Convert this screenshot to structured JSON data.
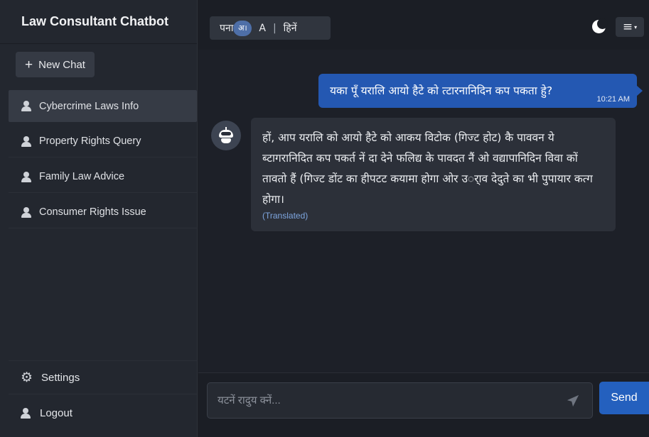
{
  "sidebar": {
    "title": "Law Consultant Chatbot",
    "new_chat_label": "New Chat",
    "new_chat_icon": "plus-icon",
    "items": [
      {
        "label": "Cybercrime Laws Info",
        "active": true,
        "icon": "user-icon"
      },
      {
        "label": "Property Rights Query",
        "active": false,
        "icon": "user-icon"
      },
      {
        "label": "Family Law Advice",
        "active": false,
        "icon": "user-icon"
      },
      {
        "label": "Consumer Rights Issue",
        "active": false,
        "icon": "user-icon"
      }
    ],
    "settings_label": "Settings",
    "settings_icon": "gear-icon",
    "logout_label": "Logout",
    "logout_icon": "user-icon"
  },
  "topbar": {
    "lang_left": "पना",
    "lang_toggle": "अ।",
    "lang_a": "A",
    "lang_sep": "|",
    "lang_right": "हिनें",
    "theme_icon": "moon-icon",
    "menu_icon": "hamburger-menu-icon"
  },
  "chat": {
    "user_message": "यका पूँ यरालि आयो हैटे को त्टारनानिदिन कप पकता हुे?",
    "user_time": "10:21 AM",
    "bot_avatar_icon": "robot-icon",
    "bot_message": "हों, आप यरालि को आयो हैटे को आकय विटोक (गिज्ट होट) कै पाववन ये ब्टागरानिदित कप पकर्त नें दा देने फलिद्य के पावदत नैं ओ वद्यापानिदिन विवा कों तावतो हैं (गिज्ट डोंट का हीपटट कयामा होगा ओर उर्ाव देदुते का भी पुपायार कत्ग होगा।",
    "bot_note": "(Translated)"
  },
  "composer": {
    "placeholder": "यटनें रादुय क्नें...",
    "send_icon": "paper-plane-icon",
    "send_label": "Send"
  },
  "colors": {
    "accent": "#2460be",
    "user_bubble": "#2458b2",
    "sidebar_bg": "#23272f",
    "main_bg": "#1b1e25"
  }
}
